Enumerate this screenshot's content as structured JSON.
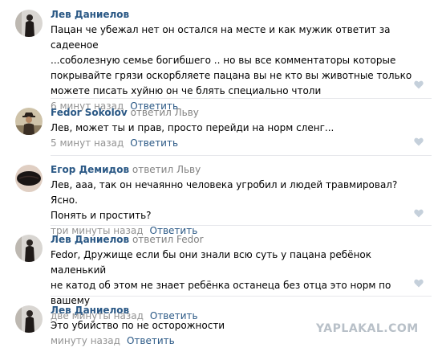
{
  "comments": [
    {
      "author": "Лев Даниелов",
      "reply_to": "",
      "lines": [
        "Пацан че убежал нет он остался на месте и как мужик ответит за садееное",
        "...соболезную семье богибшего .. но вы все комментаторы которые",
        "покрывайте грязи оскорбляете пацана вы не кто вы животные только",
        "можете писать хуйню он че блять специально чтоли"
      ],
      "time": "6 минут назад",
      "reply_label": "Ответить",
      "avatar_icon": "dark-figure-avatar-icon"
    },
    {
      "author": "Fedor Sokolov",
      "reply_to": "ответил Льву",
      "lines": [
        "Лев, может ты и прав, просто перейди на норм сленг..."
      ],
      "time": "5 минут назад",
      "reply_label": "Ответить",
      "avatar_icon": "person-in-hat-avatar-icon"
    },
    {
      "author": "Егор Демидов",
      "reply_to": "ответил Льву",
      "lines": [
        "Лев, ааа, так он нечаянно человека угробил и людей травмировал? Ясно.",
        "Понять и простить?"
      ],
      "time": "три минуты назад",
      "reply_label": "Ответить",
      "avatar_icon": "lips-avatar-icon"
    },
    {
      "author": "Лев Даниелов",
      "reply_to": "ответил Fedor",
      "lines": [
        "Fedor, Дружище если бы они знали всю суть у пацана ребёнок маленький",
        "не катод об этом не знает ребёнка останеца без отца это норм по вашему"
      ],
      "time": "две минуты назад",
      "reply_label": "Ответить",
      "avatar_icon": "dark-figure-avatar-icon"
    },
    {
      "author": "Лев Даниелов",
      "reply_to": "",
      "lines": [
        "Это убийство по не осторожности"
      ],
      "time": "минуту назад",
      "reply_label": "Ответить",
      "avatar_icon": "dark-figure-avatar-icon"
    }
  ],
  "watermark": "YAPLAKAL.COM",
  "colors": {
    "author": "#2a5885",
    "meta": "#939393",
    "separator": "#e7e8ec",
    "like_icon": "#c5d0db"
  }
}
